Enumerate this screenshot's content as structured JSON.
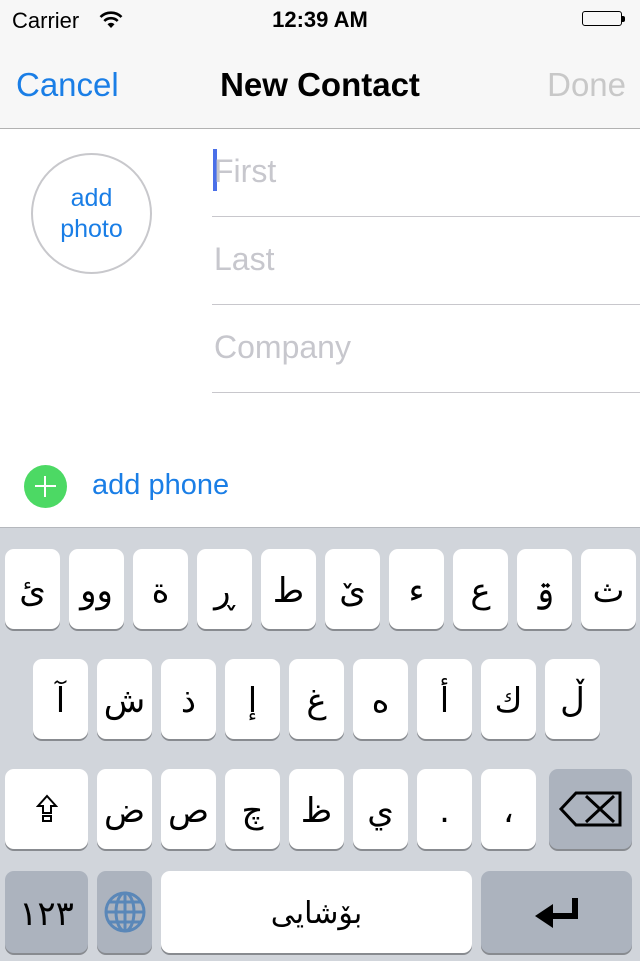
{
  "status_bar": {
    "carrier": "Carrier",
    "time": "12:39 AM",
    "wifi_icon": "wifi-icon",
    "battery_icon": "battery-full-icon"
  },
  "nav": {
    "cancel_label": "Cancel",
    "title": "New Contact",
    "done_label": "Done"
  },
  "contact": {
    "add_photo_line1": "add",
    "add_photo_line2": "photo",
    "first_placeholder": "First",
    "first_value": "",
    "last_placeholder": "Last",
    "last_value": "",
    "company_placeholder": "Company",
    "company_value": "",
    "add_phone_label": "add phone",
    "add_phone_icon": "plus-circle-icon"
  },
  "colors": {
    "accent": "#1a7ee6",
    "add_green": "#4cd964",
    "disabled": "#c8c8c8",
    "keyboard_bg": "#d1d5db",
    "dark_key": "#acb3be"
  },
  "keyboard": {
    "row1": [
      "ئ",
      "وو",
      "ة",
      "ڕ",
      "ط",
      "ێ",
      "ء",
      "ع",
      "ۊ",
      "ث"
    ],
    "row2": [
      "آ",
      "ش",
      "ذ",
      "إ",
      "غ",
      "ه",
      "أ",
      "ك",
      "ڵ"
    ],
    "row3": [
      "ض",
      "ص",
      "چ",
      "ظ",
      "ي",
      ".",
      "،"
    ],
    "shift_icon": "shift-icon",
    "delete_icon": "backspace-icon",
    "numbers_label": "١٢٣",
    "globe_icon": "globe-icon",
    "space_label": "بۆشایی",
    "return_icon": "return-icon"
  }
}
